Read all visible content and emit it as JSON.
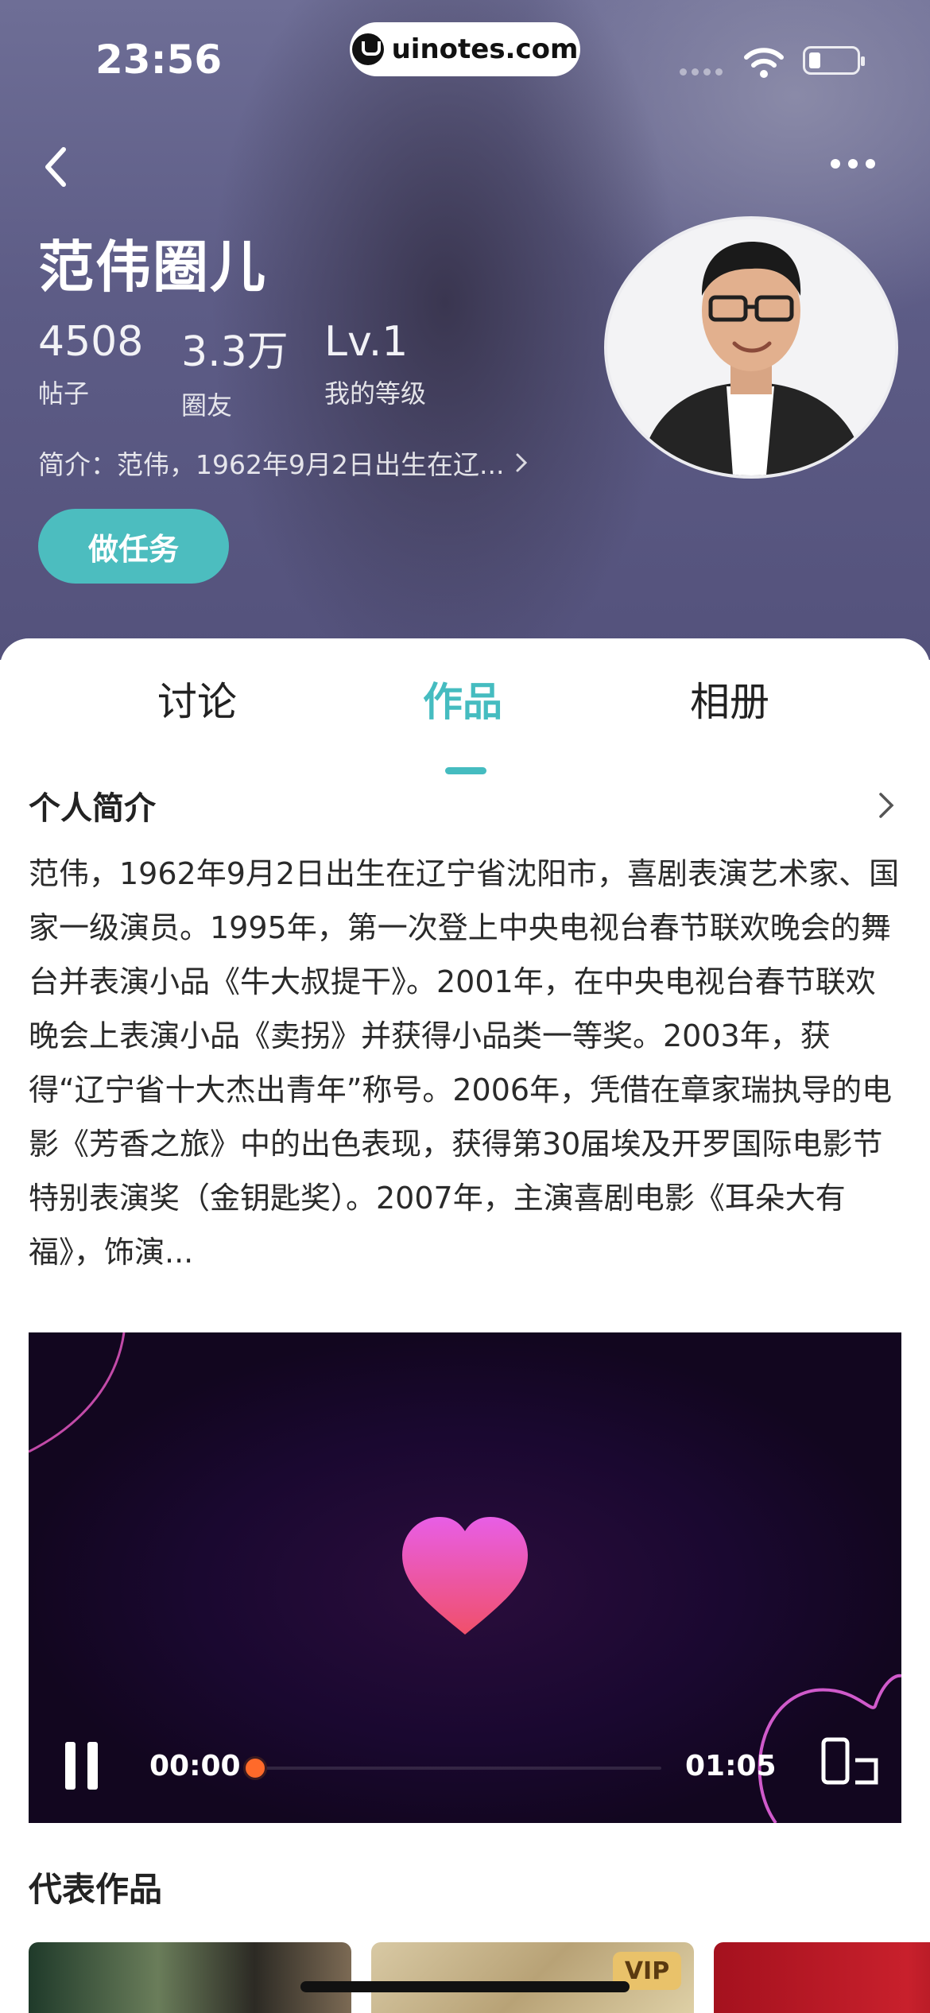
{
  "status_bar": {
    "time": "23:56",
    "url": "uinotes.com"
  },
  "header": {
    "title": "范伟圈儿",
    "stats": [
      {
        "value": "4508",
        "label": "帖子"
      },
      {
        "value": "3.3万",
        "label": "圈友"
      },
      {
        "value": "Lv.1",
        "label": "我的等级"
      }
    ],
    "intro": "简介：范伟，1962年9月2日出生在辽...",
    "task_button": "做任务"
  },
  "tabs": [
    {
      "label": "讨论",
      "active": false
    },
    {
      "label": "作品",
      "active": true
    },
    {
      "label": "相册",
      "active": false
    }
  ],
  "profile": {
    "section_title": "个人简介",
    "bio": "范伟，1962年9月2日出生在辽宁省沈阳市，喜剧表演艺术家、国家一级演员。1995年，第一次登上中央电视台春节联欢晚会的舞台并表演小品《牛大叔提干》。2001年，在中央电视台春节联欢晚会上表演小品《卖拐》并获得小品类一等奖。2003年，获得“辽宁省十大杰出青年”称号。2006年，凭借在章家瑞执导的电影《芳香之旅》中的出色表现，获得第30届埃及开罗国际电影节特别表演奖（金钥匙奖）。2007年，主演喜剧电影《耳朵大有福》，饰演..."
  },
  "video": {
    "current_time": "00:00",
    "duration": "01:05",
    "progress": 0.0
  },
  "works": {
    "title": "代表作品",
    "badge": "VIP"
  },
  "colors": {
    "accent": "#45bcc0",
    "progress": "#ff6a2a"
  },
  "icons": [
    "back-icon",
    "more-icon",
    "chevron-right-icon",
    "heart-icon",
    "pause-icon",
    "rotate-screen-icon",
    "wifi-icon",
    "battery-icon"
  ]
}
